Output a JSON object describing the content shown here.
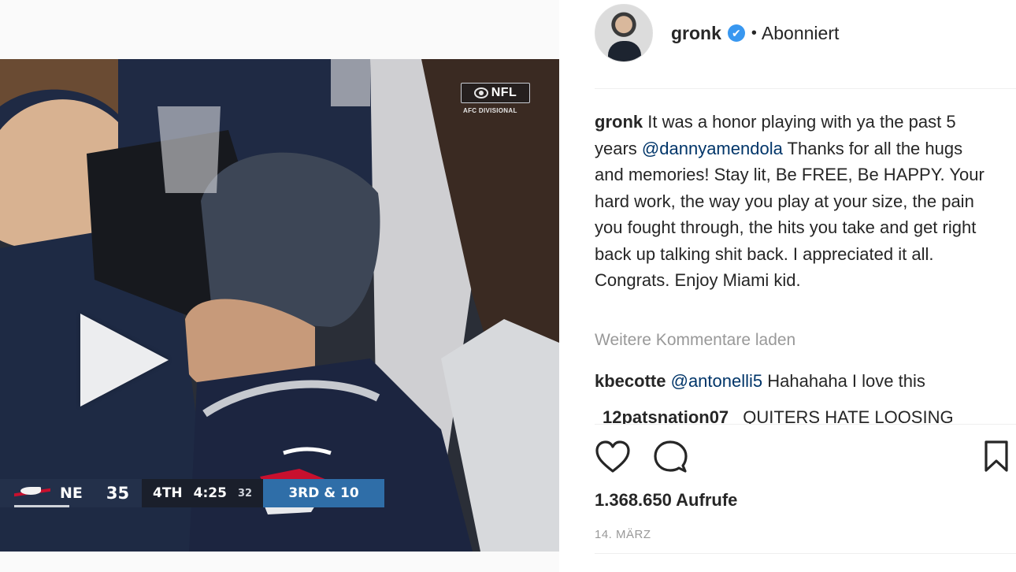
{
  "header": {
    "username": "gronk",
    "verified_glyph": "✔",
    "separator": "•",
    "follow_status": "Abonniert"
  },
  "video": {
    "network_logo_text": "NFL",
    "game_label": "AFC DIVISIONAL",
    "scorebug": {
      "team": "NE",
      "score": "35",
      "quarter": "4TH",
      "clock": "4:25",
      "play_clock": "32",
      "down_distance": "3RD & 10"
    }
  },
  "caption": {
    "username": "gronk",
    "text_before_mention": "It was a honor playing with ya the past 5 years",
    "mention": "@dannyamendola",
    "text_after_mention": "Thanks for all the hugs and memories! Stay lit, Be FREE, Be HAPPY. Your hard work, the way you play at your size, the pain you fought through, the hits you take and get right back up talking shit back. I appreciated it all. Congrats. Enjoy Miami kid."
  },
  "load_more_label": "Weitere Kommentare laden",
  "comments": [
    {
      "username": "kbecotte",
      "mention": "@antonelli5",
      "text": "Hahahaha I love this"
    },
    {
      "username": "12patsnation07",
      "mention": "",
      "text": "QUITERS HATE LOOSING"
    }
  ],
  "views_label": "1.368.650 Aufrufe",
  "date_label": "14. MÄRZ",
  "icons": {
    "like": "heart-icon",
    "comment": "speech-bubble-icon",
    "save": "bookmark-icon",
    "play": "play-icon"
  }
}
